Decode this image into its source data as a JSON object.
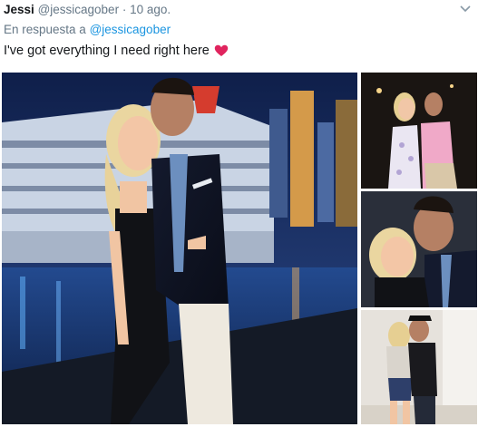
{
  "tweet": {
    "author_name": "Jessi",
    "author_handle": "@jessicagober",
    "separator": "·",
    "date": "10 ago.",
    "reply_prefix": "En respuesta a",
    "reply_handle": "@jessicagober",
    "text": "I've got everything I need right here",
    "emoji": "heart-emoji"
  },
  "media": {
    "photos": [
      "main-couple-photo",
      "couple-party-photo",
      "couple-selfie-photo",
      "couple-kiss-photo"
    ]
  },
  "colors": {
    "link": "#1b95e0",
    "secondary_text": "#657786",
    "heart": "#e0245e"
  }
}
